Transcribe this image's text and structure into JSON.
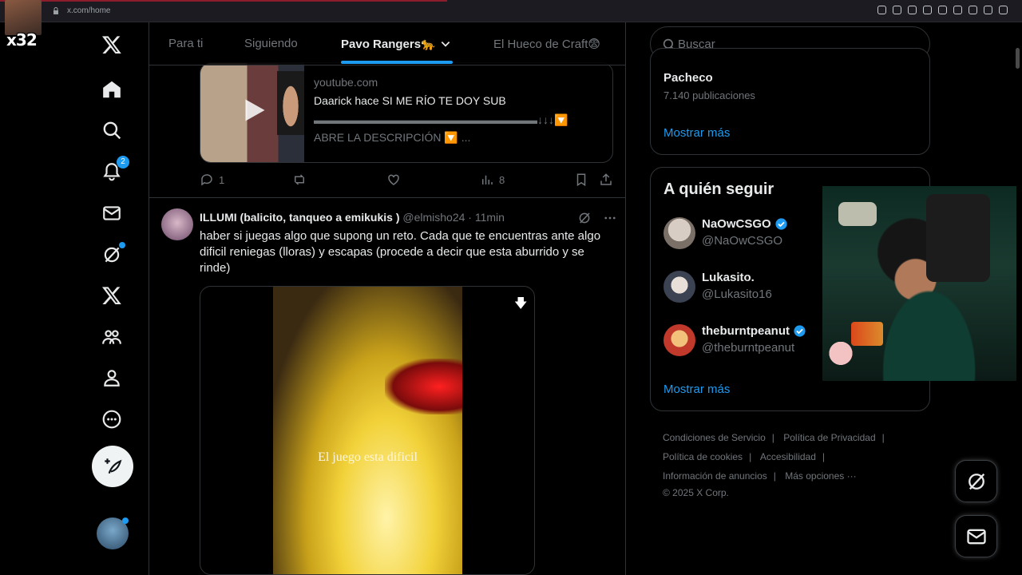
{
  "browser": {
    "url": "x.com/home"
  },
  "overlay": {
    "multiplier": "x32"
  },
  "nav": {
    "notifications_badge": "2"
  },
  "tabs": [
    {
      "label": "Para ti"
    },
    {
      "label": "Siguiendo"
    },
    {
      "label": "Pavo Rangers🐆"
    },
    {
      "label": "El Hueco de Craft😨"
    }
  ],
  "card": {
    "domain": "youtube.com",
    "title": "Daarick hace SI ME RÍO TE DOY SUB",
    "description": "▬▬▬▬▬▬▬▬▬▬▬▬▬▬▬▬▬▬▬▬↓↓↓🔽 ABRE LA DESCRIPCIÓN 🔽 ..."
  },
  "card_actions": {
    "replies": "1",
    "views": "8"
  },
  "tweet": {
    "name": "ILLUMI (balicito, tanqueo a emikukis )",
    "handle": "@elmisho24",
    "time": "· 11min",
    "text": "haber si juegas algo que supong  un reto. Cada que te encuentras ante algo dificil reniegas (lloras)  y escapas (procede a decir que esta aburrido y se rinde)",
    "video_subtitle": "El juego esta dificil"
  },
  "search": {
    "placeholder": "Buscar"
  },
  "trend": {
    "name": "Pacheco",
    "count": "7.140 publicaciones",
    "show_more": "Mostrar más"
  },
  "who_to_follow": {
    "title": "A quién seguir",
    "show_more": "Mostrar más",
    "users": [
      {
        "name": "NaOwCSGO",
        "handle": "@NaOwCSGO",
        "verified": true
      },
      {
        "name": "Lukasito.",
        "handle": "@Lukasito16",
        "verified": false
      },
      {
        "name": "theburntpeanut",
        "handle": "@theburntpeanut",
        "verified": true
      }
    ]
  },
  "footer": {
    "links": [
      "Condiciones de Servicio",
      "Política de Privacidad",
      "Política de cookies",
      "Accesibilidad",
      "Información de anuncios",
      "Más opciones ···"
    ],
    "copyright": "© 2025 X Corp."
  },
  "colors": {
    "accent": "#1d9bf0",
    "background": "#000000",
    "border": "#2f3336",
    "muted": "#71767b"
  }
}
